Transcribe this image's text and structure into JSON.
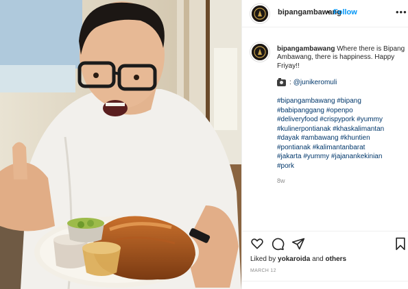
{
  "post": {
    "username": "bipangambawang",
    "separator": "•",
    "follow_label": "Follow",
    "more_label": "•••",
    "caption_text": "Where there is Bipang Ambawang, there is happiness. Happy Friyay!!",
    "credit_handle": "@junikeromuli",
    "hashtags": [
      "#bipangambawang #bipang",
      "#babipanggang #openpo",
      "#deliveryfood #crispypork #yummy",
      "#kulinerpontianak #khaskalimantan",
      "#dayak #ambawang #khuntien",
      "#pontianak #kalimantanbarat",
      "#jakarta #yummy #jajanankekinian",
      "#pork"
    ],
    "age": "8w",
    "liked_by_prefix": "Liked by",
    "liked_by_user": "yokaroida",
    "liked_by_and": "and",
    "liked_by_others": "others",
    "date": "MARCH 12"
  },
  "icons": {
    "like": "heart-icon",
    "comment": "comment-icon",
    "share": "paper-plane-icon",
    "save": "bookmark-icon",
    "camera": "camera-icon"
  },
  "colors": {
    "accent": "#0095f6",
    "link": "#00376b",
    "muted": "#8e8e8e",
    "text": "#262626"
  }
}
